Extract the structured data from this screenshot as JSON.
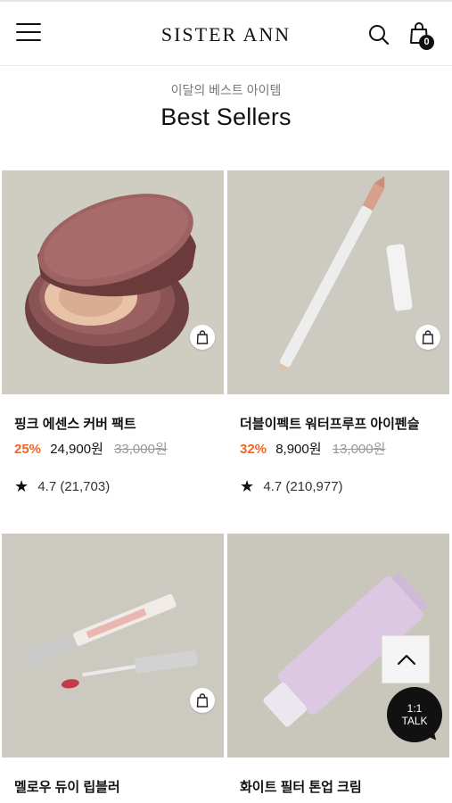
{
  "header": {
    "logo": "SISTER ANN",
    "cart_count": "0",
    "icons": [
      "hamburger-menu-icon",
      "search-icon",
      "shopping-bag-icon"
    ]
  },
  "section": {
    "subtitle": "이달의 베스트 아이템",
    "title": "Best Sellers"
  },
  "products": [
    {
      "name": "핑크 에센스 커버 팩트",
      "discount": "25%",
      "price": "24,900원",
      "original_price": "33,000원",
      "rating": "4.7 (21,703)"
    },
    {
      "name": "더블이펙트 워터프루프 아이펜슬",
      "discount": "32%",
      "price": "8,900원",
      "original_price": "13,000원",
      "rating": "4.7 (210,977)"
    },
    {
      "name": "멜로우 듀이 립블러"
    },
    {
      "name": "화이트 필터 톤업 크림"
    }
  ],
  "floating": {
    "talk_line1": "1:1",
    "talk_line2": "TALK"
  },
  "colors": {
    "accent_discount": "#f26522",
    "thumb_background": "#cdcbc2",
    "talk_background": "#111111"
  }
}
